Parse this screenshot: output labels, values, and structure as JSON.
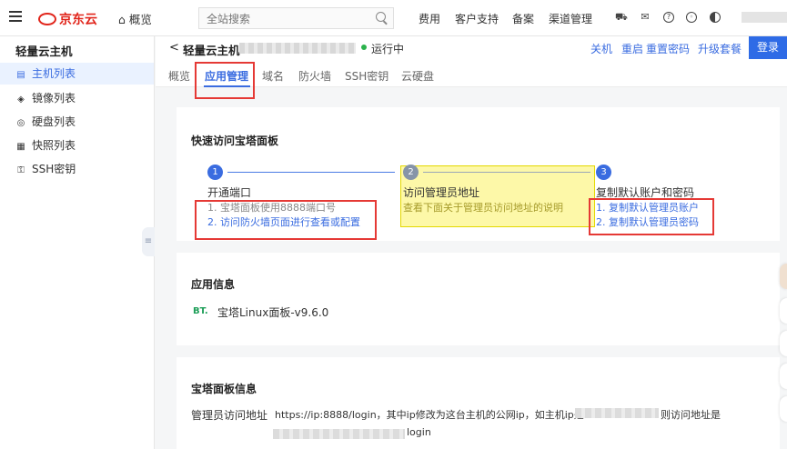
{
  "topbar": {
    "logo_text": "京东云",
    "overview_label": "概览",
    "search_placeholder": "全站搜索",
    "nav": [
      "费用",
      "客户支持",
      "备案",
      "渠道管理"
    ]
  },
  "sidebar": {
    "title": "轻量云主机",
    "items": [
      {
        "label": "主机列表",
        "icon": "list-icon",
        "active": true
      },
      {
        "label": "镜像列表",
        "icon": "image-icon",
        "active": false
      },
      {
        "label": "硬盘列表",
        "icon": "disk-icon",
        "active": false
      },
      {
        "label": "快照列表",
        "icon": "snapshot-icon",
        "active": false
      },
      {
        "label": "SSH密钥",
        "icon": "key-icon",
        "active": false
      }
    ]
  },
  "header": {
    "back_glyph": "<",
    "title": "轻量云主机",
    "status": "运行中",
    "status_color": "#2bb24c",
    "actions": [
      "关机",
      "重启",
      "重置密码",
      "升级套餐"
    ],
    "login_label": "登录",
    "tabs": [
      {
        "label": "概览",
        "active": false
      },
      {
        "label": "应用管理",
        "active": true
      },
      {
        "label": "域名",
        "active": false
      },
      {
        "label": "防火墙",
        "active": false
      },
      {
        "label": "SSH密钥",
        "active": false
      },
      {
        "label": "云硬盘",
        "active": false
      }
    ]
  },
  "quick_access": {
    "title": "快速访问宝塔面板",
    "steps": [
      {
        "num": "1",
        "title": "开通端口",
        "lines": [
          "1. 宝塔面板使用8888端口号",
          "2. 访问防火墙页面进行查看或配置"
        ]
      },
      {
        "num": "2",
        "title": "访问管理员地址",
        "lines": [
          "查看下面关于管理员访问地址的说明"
        ]
      },
      {
        "num": "3",
        "title": "复制默认账户和密码",
        "lines": [
          "1. 复制默认管理员账户",
          "2. 复制默认管理员密码"
        ]
      }
    ]
  },
  "app_info": {
    "title": "应用信息",
    "logo_text": "BT.",
    "name": "宝塔Linux面板-v9.6.0"
  },
  "panel_info": {
    "title": "宝塔面板信息",
    "label": "管理员访问地址",
    "value_prefix": "https://ip:8888/login，其中ip修改为这台主机的公网ip，如主机ip是",
    "value_middle": "则访问地址是",
    "value_suffix": "login"
  },
  "colors": {
    "accent": "#3a6ce0",
    "brand_red": "#e1251b",
    "annotation_red": "#e53935",
    "highlight_yellow": "#fdf8a8"
  }
}
